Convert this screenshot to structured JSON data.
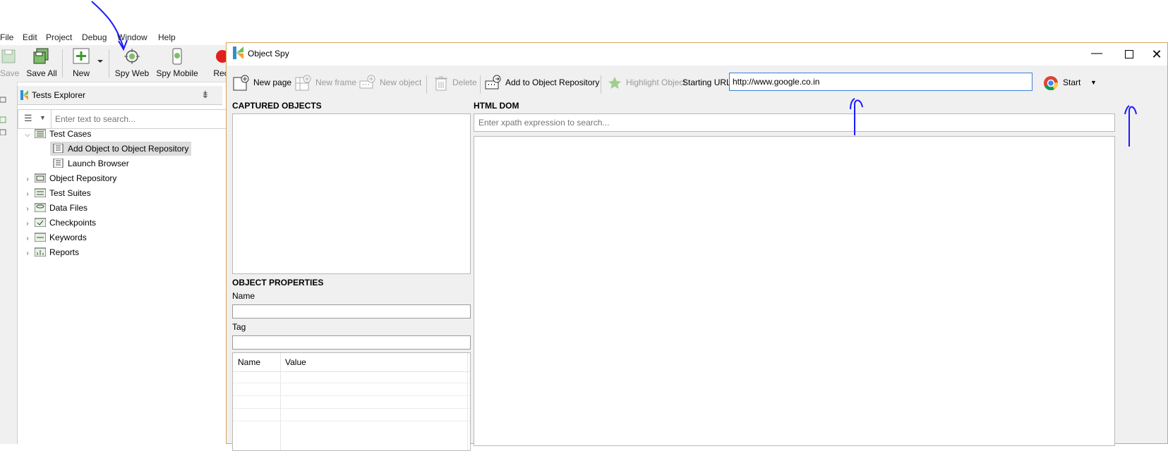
{
  "menu": [
    "File",
    "Edit",
    "Project",
    "Debug",
    "Window",
    "Help"
  ],
  "toolbar": {
    "save": "Save",
    "save_all": "Save All",
    "new": "New",
    "spy_web": "Spy Web",
    "spy_mobile": "Spy Mobile",
    "record": "Rec"
  },
  "explorer": {
    "tab_title": "Tests Explorer",
    "search_placeholder": "Enter text to search...",
    "tree": [
      {
        "label": "Test Cases",
        "expanded": true
      },
      {
        "label": "Add Object to Object Repository",
        "selected": true
      },
      {
        "label": "Launch Browser"
      },
      {
        "label": "Object Repository"
      },
      {
        "label": "Test Suites"
      },
      {
        "label": "Data Files"
      },
      {
        "label": "Checkpoints"
      },
      {
        "label": "Keywords"
      },
      {
        "label": "Reports"
      }
    ]
  },
  "spy": {
    "title": "Object Spy",
    "toolbar": {
      "new_page": "New page",
      "new_frame": "New frame",
      "new_object": "New object",
      "delete": "Delete",
      "add_to_repo": "Add to Object Repository",
      "highlight": "Highlight Object",
      "starting_url_label": "Starting URL",
      "starting_url_value": "http://www.google.co.in",
      "start": "Start"
    },
    "captured_objects": "CAPTURED OBJECTS",
    "html_dom": "HTML DOM",
    "xpath_placeholder": "Enter xpath expression to search...",
    "object_properties": "OBJECT PROPERTIES",
    "name_label": "Name",
    "tag_label": "Tag",
    "table_headers": [
      "Name",
      "Value"
    ]
  },
  "colors": {
    "accent_green": "#4a9b2f",
    "annotation_blue": "#1a1aff",
    "window_border": "#d6a45a"
  }
}
